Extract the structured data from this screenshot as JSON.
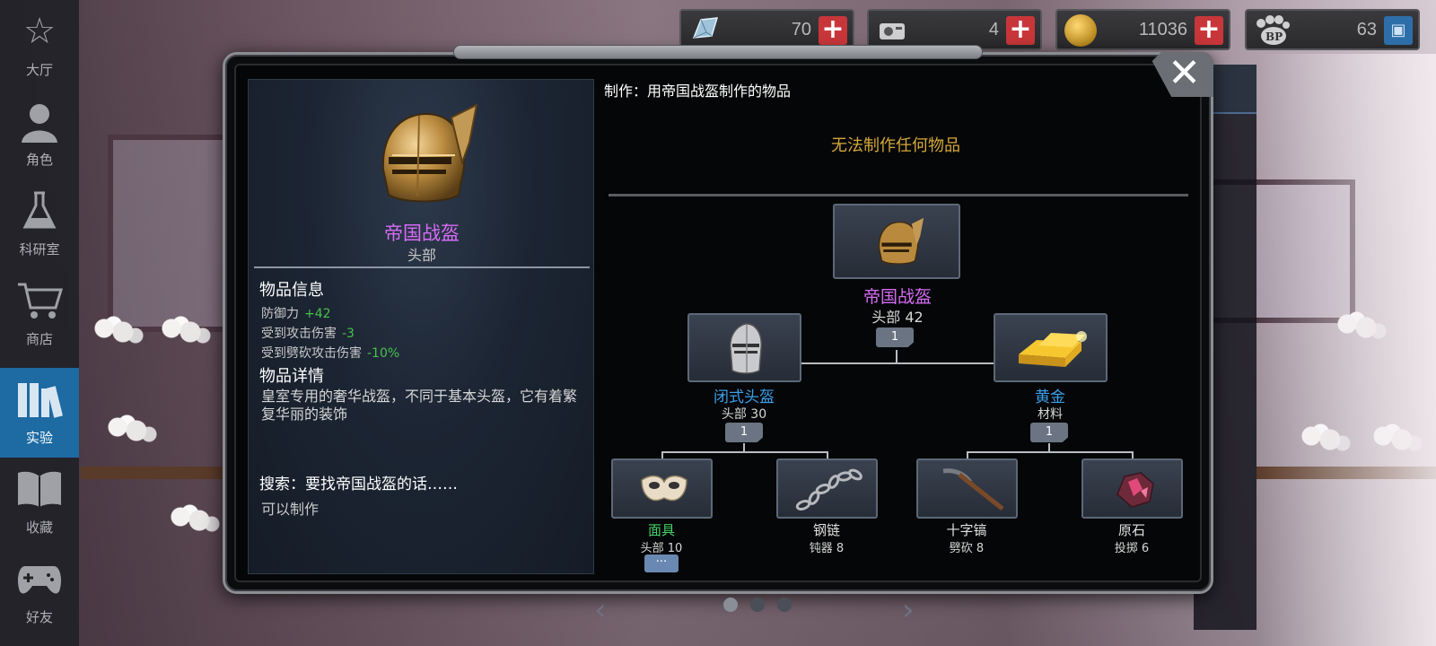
{
  "sidebar": {
    "items": [
      {
        "label": "大厅",
        "icon": "star-outline-icon",
        "active": false
      },
      {
        "label": "角色",
        "icon": "character-portrait-icon",
        "active": false
      },
      {
        "label": "科研室",
        "icon": "flask-icon",
        "active": false
      },
      {
        "label": "商店",
        "icon": "shopping-cart-icon",
        "active": false
      },
      {
        "label": "实验",
        "icon": "books-icon",
        "active": true
      },
      {
        "label": "收藏",
        "icon": "open-book-icon",
        "active": false
      },
      {
        "label": "好友",
        "icon": "gamepad-icon",
        "active": false
      }
    ]
  },
  "currencies": [
    {
      "icon": "crystal-icon",
      "value": "70",
      "action": "plus-icon"
    },
    {
      "icon": "disk-drive-icon",
      "value": "4",
      "action": "plus-icon"
    },
    {
      "icon": "gold-coin-icon",
      "value": "11036",
      "action": "plus-icon"
    },
    {
      "icon": "bp-paw-icon",
      "value": "63",
      "action": "card-icon"
    }
  ],
  "item": {
    "name": "帝国战盔",
    "slot": "头部",
    "info_heading": "物品信息",
    "stats": [
      {
        "label": "防御力",
        "value": "+42"
      },
      {
        "label": "受到攻击伤害",
        "value": "-3"
      },
      {
        "label": "受到劈砍攻击伤害",
        "value": "-10%"
      }
    ],
    "detail_heading": "物品详情",
    "description": "皇室专用的奢华战盔，不同于基本头盔，它有着繁复华丽的装饰",
    "search_heading": "搜索：要找帝国战盔的话……",
    "search_value": "可以制作"
  },
  "craft": {
    "title": "制作：用帝国战盔制作的物品",
    "none_message": "无法制作任何物品",
    "root": {
      "name": "帝国战盔",
      "sub": "头部 42",
      "qty": "1",
      "color": "#d56cf5",
      "icon": "golden-helmet-icon"
    },
    "level1": [
      {
        "name": "闭式头盔",
        "sub": "头部 30",
        "qty": "1",
        "color": "#3aa0ea",
        "icon": "closed-helmet-icon"
      },
      {
        "name": "黄金",
        "sub": "材料",
        "qty": "1",
        "color": "#3aa0ea",
        "icon": "gold-bars-icon"
      }
    ],
    "level2": [
      {
        "name": "面具",
        "sub": "头部 10",
        "color": "#46d06a",
        "icon": "mask-icon",
        "more": "···"
      },
      {
        "name": "钢链",
        "sub": "钝器 8",
        "color": "#e0e0e0",
        "icon": "chain-icon"
      },
      {
        "name": "十字镐",
        "sub": "劈砍 8",
        "color": "#e0e0e0",
        "icon": "pickaxe-icon"
      },
      {
        "name": "原石",
        "sub": "投掷 6",
        "color": "#e0e0e0",
        "icon": "ore-stone-icon"
      }
    ]
  },
  "pager": {
    "pages": 3,
    "current": 1
  },
  "colors": {
    "accent": "#1e6aa3",
    "rare": "#d56cf5",
    "uncommon": "#3aa0ea",
    "common_green": "#46d06a",
    "warning": "#d4a93a",
    "stat_positive": "#46c24b"
  }
}
